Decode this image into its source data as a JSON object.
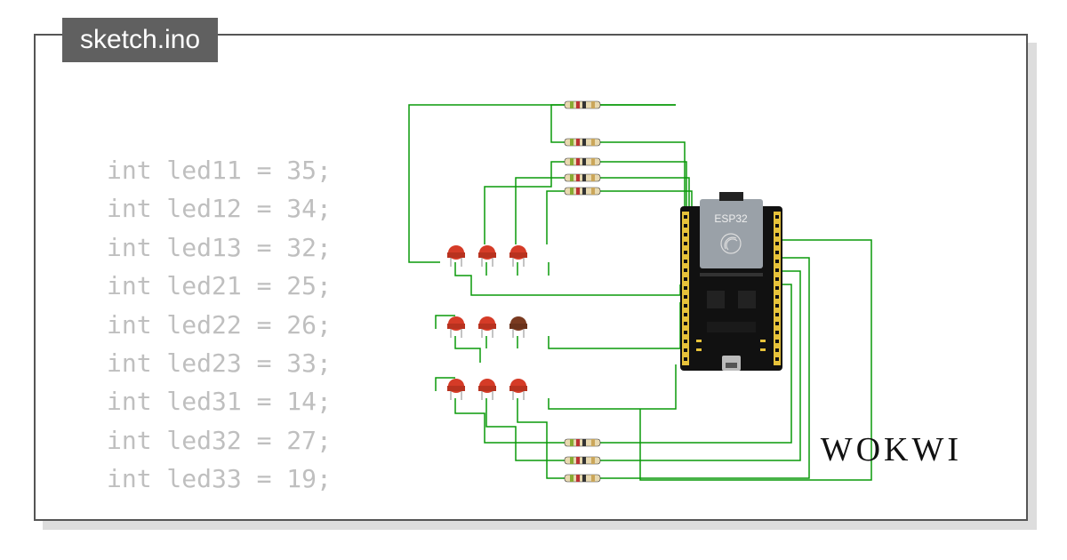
{
  "tab": {
    "filename": "sketch.ino"
  },
  "code": {
    "lines": [
      "int led11 = 35;",
      "int led12 = 34;",
      "int led13 = 32;",
      "int led21 = 25;",
      "int led22 = 26;",
      "int led23 = 33;",
      "int led31 = 14;",
      "int led32 = 27;",
      "int led33 = 19;"
    ]
  },
  "board": {
    "label": "ESP32"
  },
  "brand": "WOKWI",
  "colors": {
    "wire": "#0a9a0a",
    "led_red": "#d53b27",
    "led_dark": "#7a3a20",
    "board_pcb": "#111",
    "board_shield": "#9aa1a8",
    "board_pin": "#e6c23a",
    "resistor_body": "#e8d9b0"
  }
}
